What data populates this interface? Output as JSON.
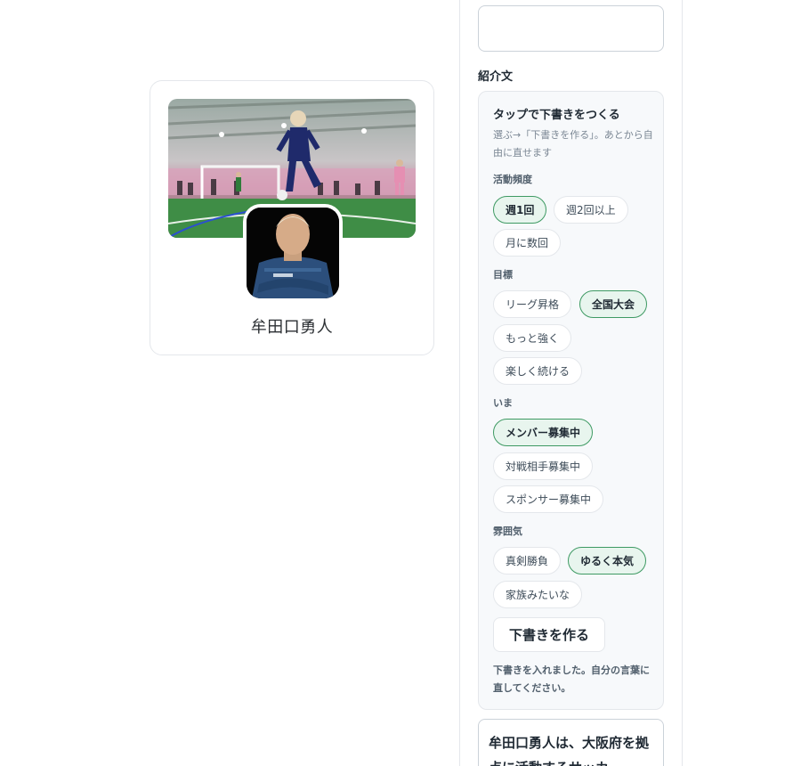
{
  "profile": {
    "name": "牟田口勇人",
    "cover_image": "futsal-action-photo",
    "avatar_image": "player-portrait"
  },
  "panel": {
    "intro_label": "紹介文",
    "helper": {
      "title": "タップで下書きをつくる",
      "description": "選ぶ→「下書きを作る」。あとから自由に直せます",
      "groups": [
        {
          "label": "活動頻度",
          "options": [
            {
              "label": "週1回",
              "selected": true
            },
            {
              "label": "週2回以上",
              "selected": false
            },
            {
              "label": "月に数回",
              "selected": false
            }
          ]
        },
        {
          "label": "目標",
          "options": [
            {
              "label": "リーグ昇格",
              "selected": false
            },
            {
              "label": "全国大会",
              "selected": true
            },
            {
              "label": "もっと強く",
              "selected": false
            },
            {
              "label": "楽しく続ける",
              "selected": false
            }
          ]
        },
        {
          "label": "いま",
          "options": [
            {
              "label": "メンバー募集中",
              "selected": true
            },
            {
              "label": "対戦相手募集中",
              "selected": false
            },
            {
              "label": "スポンサー募集中",
              "selected": false
            }
          ]
        },
        {
          "label": "雰囲気",
          "options": [
            {
              "label": "真剣勝負",
              "selected": false
            },
            {
              "label": "ゆるく本気",
              "selected": true
            },
            {
              "label": "家族みたいな",
              "selected": false
            }
          ]
        }
      ],
      "button_label": "下書きを作る",
      "note": "下書きを入れました。自分の言葉に直してください。"
    },
    "intro_text": "牟田口勇人は、大阪府を拠点に活動するサッカ"
  },
  "colors": {
    "selected_border": "#3e9a63",
    "selected_fill": "#e8f5ee"
  }
}
